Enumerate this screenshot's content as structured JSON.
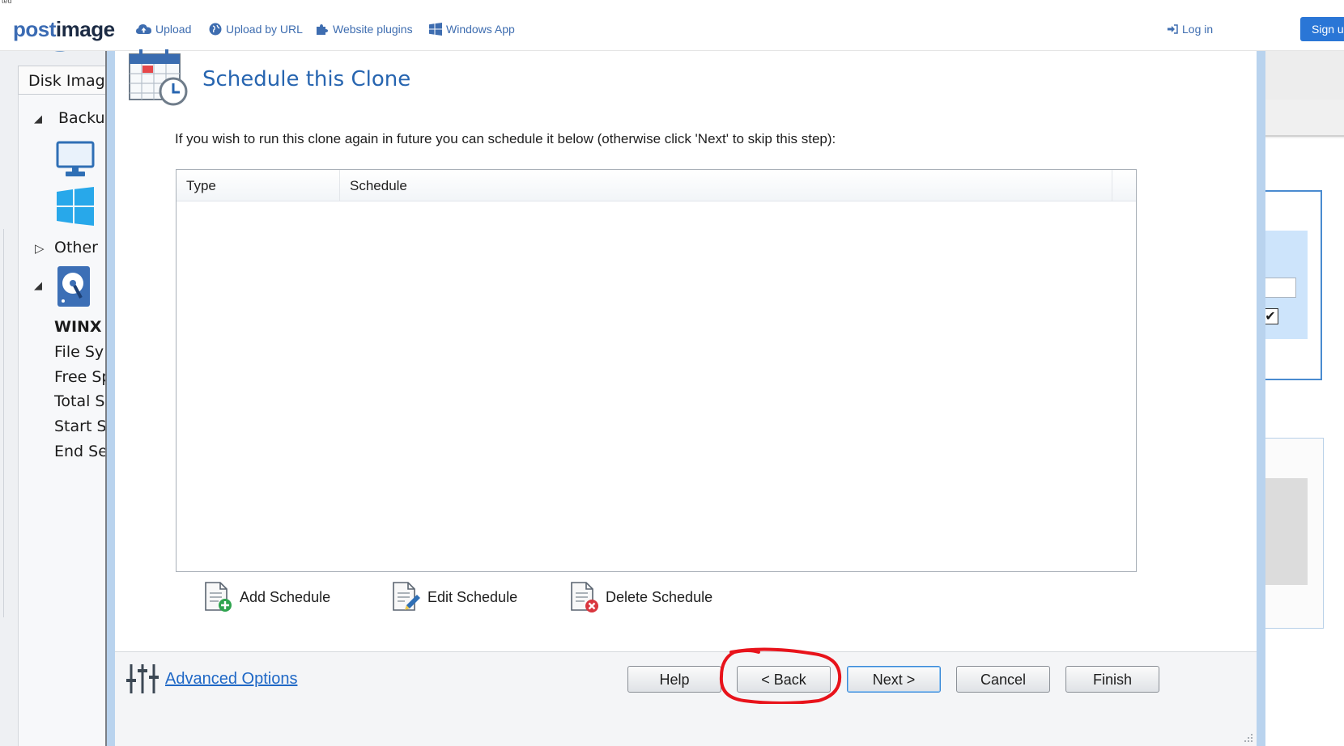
{
  "browser": {
    "corner_text": "ted"
  },
  "postimage": {
    "logo_prefix": "post",
    "logo_suffix": "image",
    "nav": [
      {
        "label": "Upload",
        "icon": "cloud-upload-icon"
      },
      {
        "label": "Upload by URL",
        "icon": "globe-icon"
      },
      {
        "label": "Website plugins",
        "icon": "puzzle-icon"
      },
      {
        "label": "Windows App",
        "icon": "windows-icon"
      }
    ],
    "login": "Log in",
    "signup": "Sign u"
  },
  "left_panel": {
    "tab_label": "Disk Image",
    "tree": {
      "backup_label": "Backu",
      "other_label": "Other",
      "disk_name": "WINX",
      "details": [
        "File Sy",
        "Free Sp",
        "Total S",
        "Start S",
        "End Se"
      ]
    }
  },
  "dialog": {
    "title": "Schedule this Clone",
    "instruction": "If you wish to run this clone again in future you can schedule it below (otherwise click 'Next' to skip this step):",
    "table": {
      "columns": [
        "Type",
        "Schedule"
      ],
      "rows": []
    },
    "actions": {
      "add": "Add Schedule",
      "edit": "Edit Schedule",
      "delete": "Delete Schedule"
    },
    "footer": {
      "advanced": "Advanced Options",
      "help": "Help",
      "back": "< Back",
      "next": "Next >",
      "cancel": "Cancel",
      "finish": "Finish"
    }
  },
  "colors": {
    "title_blue": "#2765b0",
    "link_blue": "#1f68c6",
    "frame_blue": "#b9d3ee",
    "highlight_red": "#e8131b",
    "signup_blue": "#2a76d6"
  }
}
